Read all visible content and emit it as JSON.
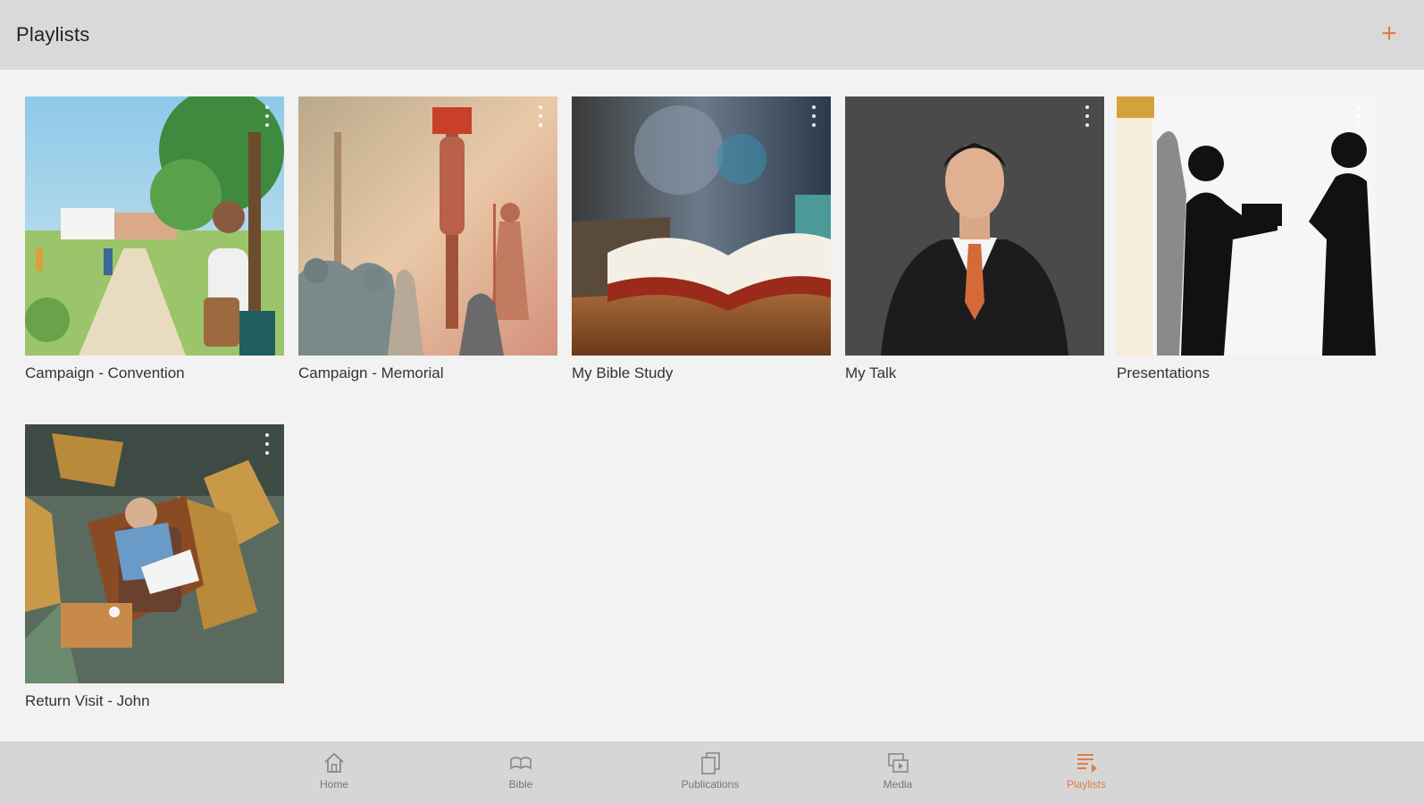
{
  "header": {
    "title": "Playlists",
    "add_label": "+"
  },
  "playlists": [
    {
      "label": "Campaign - Convention",
      "image": "people walking toward convention venue"
    },
    {
      "label": "Campaign - Memorial",
      "image": "silhouettes at execution stake"
    },
    {
      "label": "My Bible Study",
      "image": "open bible on table"
    },
    {
      "label": "My Talk",
      "image": "man in suit portrait"
    },
    {
      "label": "Presentations",
      "image": "silhouettes presenting at door"
    },
    {
      "label": "Return Visit - John",
      "image": "man reading in armchair"
    }
  ],
  "nav": {
    "items": [
      {
        "label": "Home",
        "icon": "home-icon",
        "active": false
      },
      {
        "label": "Bible",
        "icon": "bible-icon",
        "active": false
      },
      {
        "label": "Publications",
        "icon": "publications-icon",
        "active": false
      },
      {
        "label": "Media",
        "icon": "media-icon",
        "active": false
      },
      {
        "label": "Playlists",
        "icon": "playlists-icon",
        "active": true
      }
    ]
  },
  "colors": {
    "accent": "#e07b4a",
    "header_bg": "#d9d9d9",
    "content_bg": "#f2f2f2",
    "nav_bg": "#d6d6d6"
  }
}
